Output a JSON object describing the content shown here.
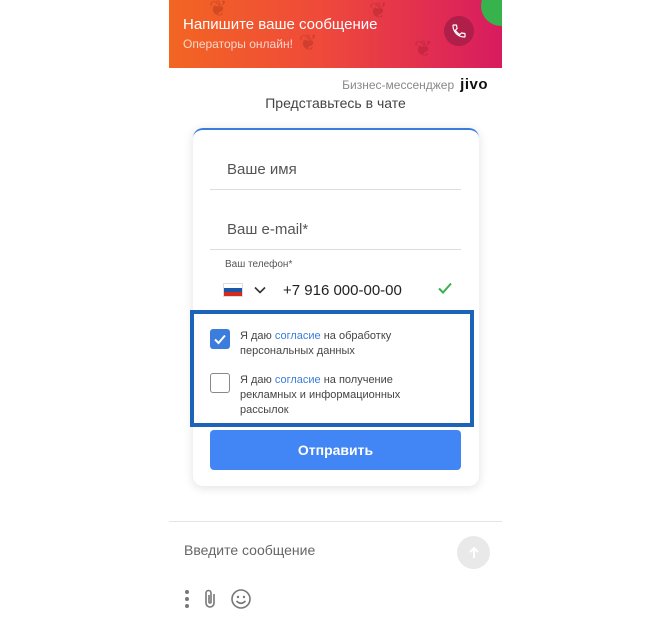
{
  "banner": {
    "title": "Напишите ваше сообщение",
    "subtitle": "Операторы онлайн!",
    "call_icon": "phone-icon"
  },
  "brand": {
    "label": "Бизнес-мессенджер",
    "logo_text": "jivo"
  },
  "intro": "Представьтесь в чате",
  "form": {
    "name_placeholder": "Ваше имя",
    "email_placeholder": "Ваш e-mail*",
    "phone_label": "Ваш телефон*",
    "phone_value": "+7 916 000-00-00",
    "country_icon": "russia-flag-icon",
    "consents": [
      {
        "checked": true,
        "prefix": "Я даю ",
        "link": "согласие",
        "suffix": " на обработку персональных данных"
      },
      {
        "checked": false,
        "prefix": "Я даю ",
        "link": "согласие",
        "suffix": " на получение рекламных и информационных рассылок"
      }
    ],
    "submit_label": "Отправить"
  },
  "composer": {
    "placeholder": "Введите сообщение",
    "send_icon": "arrow-up-icon"
  },
  "colors": {
    "accent": "#4285f4",
    "highlight": "#1d63b8",
    "valid": "#37b24d"
  }
}
